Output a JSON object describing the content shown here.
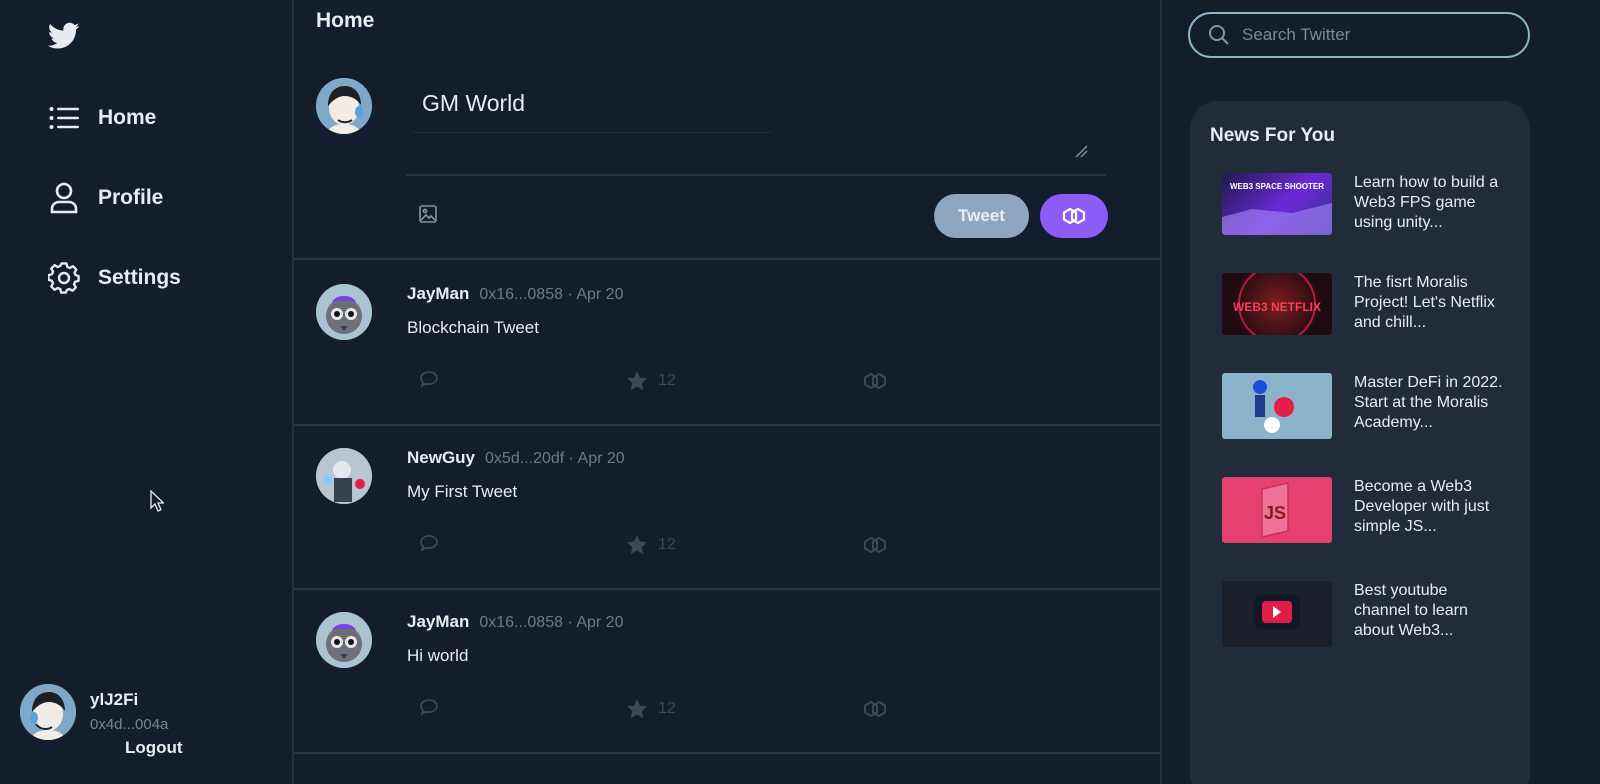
{
  "sidebar": {
    "nav": [
      {
        "label": "Home",
        "icon": "list-icon"
      },
      {
        "label": "Profile",
        "icon": "user-icon"
      },
      {
        "label": "Settings",
        "icon": "gear-icon"
      }
    ],
    "account": {
      "name": "ylJ2Fi",
      "address": "0x4d...004a",
      "logout_label": "Logout"
    }
  },
  "feed": {
    "title": "Home",
    "composer": {
      "text": "GM World",
      "tweet_label": "Tweet"
    },
    "tweets": [
      {
        "user": "JayMan",
        "meta": "0x16...0858 · Apr 20",
        "text": "Blockchain Tweet",
        "likes": "12"
      },
      {
        "user": "NewGuy",
        "meta": "0x5d...20df · Apr 20",
        "text": "My First Tweet",
        "likes": "12"
      },
      {
        "user": "JayMan",
        "meta": "0x16...0858 · Apr 20",
        "text": "Hi world",
        "likes": "12"
      }
    ]
  },
  "right": {
    "search_placeholder": "Search Twitter",
    "news_title": "News For You",
    "news": [
      {
        "text": "Learn how to build a Web3 FPS game using unity...",
        "thumb_label": "WEB3 SPACE SHOOTER"
      },
      {
        "text": "The fisrt Moralis Project! Let's Netflix and chill...",
        "thumb_label": "WEB3 NETFLIX"
      },
      {
        "text": "Master DeFi in 2022. Start at the Moralis Academy...",
        "thumb_label": ""
      },
      {
        "text": "Become a Web3 Developer with just simple JS...",
        "thumb_label": "JS"
      },
      {
        "text": "Best youtube channel to learn about Web3...",
        "thumb_label": ""
      }
    ]
  },
  "colors": {
    "background": "#141d2b",
    "panel": "#222b3a",
    "accent_purple": "#8b5cf6",
    "tweet_button": "#8ea6bf",
    "search_border": "#8cb5c9"
  }
}
